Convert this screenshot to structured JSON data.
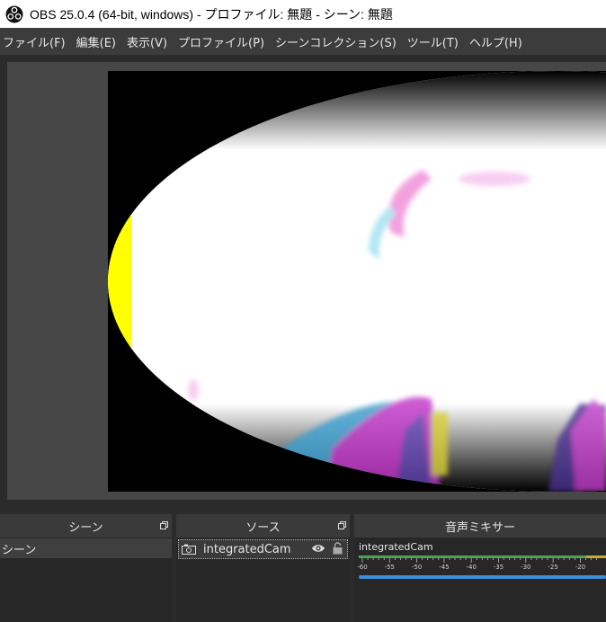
{
  "window": {
    "title": "OBS 25.0.4 (64-bit, windows) - プロファイル: 無題 - シーン: 無題"
  },
  "menu": {
    "items": [
      "ファイル(F)",
      "編集(E)",
      "表示(V)",
      "プロファイル(P)",
      "シーンコレクション(S)",
      "ツール(T)",
      "ヘルプ(H)"
    ]
  },
  "docks": {
    "scenes": {
      "title": "シーン",
      "items": [
        "シーン"
      ]
    },
    "sources": {
      "title": "ソース",
      "items": [
        "integratedCam"
      ]
    },
    "mixer": {
      "title": "音声ミキサー",
      "channel": "integratedCam",
      "ticks": [
        "-60",
        "-55",
        "-50",
        "-45",
        "-40",
        "-35",
        "-30",
        "-25",
        "-20"
      ],
      "volume_fraction": 1.0
    }
  },
  "colors": {
    "meter_green": "#4ea34e",
    "meter_yellow": "#c9a83b",
    "volume_blue": "#3b8ed8"
  }
}
